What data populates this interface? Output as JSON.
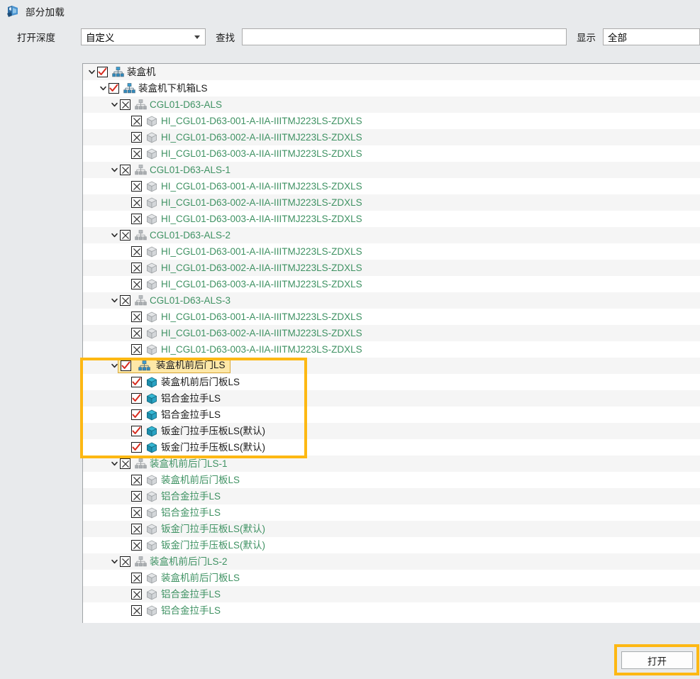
{
  "window": {
    "title": "部分加载",
    "icon": "partial-load-icon"
  },
  "toolbar": {
    "depth_label": "打开深度",
    "depth_value": "自定义",
    "find_label": "查找",
    "find_value": "",
    "find_placeholder": "",
    "show_label": "显示",
    "show_value": "全部"
  },
  "colors": {
    "highlight_border": "#fdb813",
    "selection_bg": "#fde8a8",
    "selection_border": "#d9a93a",
    "unloaded_text": "#3f9263",
    "loaded_text": "#1a1a1a",
    "check_red": "#d62b1f",
    "row_alt": "#f5f5f5",
    "panel_bg": "#e8eaec"
  },
  "tree": {
    "rows": [
      {
        "label": "装盒机",
        "depth": 0,
        "state": "checked",
        "icon": "assembly-icon-blue",
        "expanded": true,
        "text_style": "loaded",
        "selected": false
      },
      {
        "label": "装盒机下机箱LS",
        "depth": 1,
        "state": "checked",
        "icon": "assembly-icon-blue",
        "expanded": true,
        "text_style": "loaded",
        "selected": false
      },
      {
        "label": "CGL01-D63-ALS",
        "depth": 2,
        "state": "unchecked",
        "icon": "assembly-icon-gray",
        "expanded": true,
        "text_style": "unloaded",
        "selected": false
      },
      {
        "label": "HI_CGL01-D63-001-A-IIA-IIITMJ223LS-ZDXLS",
        "depth": 3,
        "state": "unchecked",
        "icon": "part-icon-gray",
        "expanded": null,
        "text_style": "unloaded",
        "selected": false
      },
      {
        "label": "HI_CGL01-D63-002-A-IIA-IIITMJ223LS-ZDXLS",
        "depth": 3,
        "state": "unchecked",
        "icon": "part-icon-gray",
        "expanded": null,
        "text_style": "unloaded",
        "selected": false
      },
      {
        "label": "HI_CGL01-D63-003-A-IIA-IIITMJ223LS-ZDXLS",
        "depth": 3,
        "state": "unchecked",
        "icon": "part-icon-gray",
        "expanded": null,
        "text_style": "unloaded",
        "selected": false
      },
      {
        "label": "CGL01-D63-ALS-1",
        "depth": 2,
        "state": "unchecked",
        "icon": "assembly-icon-gray",
        "expanded": true,
        "text_style": "unloaded",
        "selected": false
      },
      {
        "label": "HI_CGL01-D63-001-A-IIA-IIITMJ223LS-ZDXLS",
        "depth": 3,
        "state": "unchecked",
        "icon": "part-icon-gray",
        "expanded": null,
        "text_style": "unloaded",
        "selected": false
      },
      {
        "label": "HI_CGL01-D63-002-A-IIA-IIITMJ223LS-ZDXLS",
        "depth": 3,
        "state": "unchecked",
        "icon": "part-icon-gray",
        "expanded": null,
        "text_style": "unloaded",
        "selected": false
      },
      {
        "label": "HI_CGL01-D63-003-A-IIA-IIITMJ223LS-ZDXLS",
        "depth": 3,
        "state": "unchecked",
        "icon": "part-icon-gray",
        "expanded": null,
        "text_style": "unloaded",
        "selected": false
      },
      {
        "label": "CGL01-D63-ALS-2",
        "depth": 2,
        "state": "unchecked",
        "icon": "assembly-icon-gray",
        "expanded": true,
        "text_style": "unloaded",
        "selected": false
      },
      {
        "label": "HI_CGL01-D63-001-A-IIA-IIITMJ223LS-ZDXLS",
        "depth": 3,
        "state": "unchecked",
        "icon": "part-icon-gray",
        "expanded": null,
        "text_style": "unloaded",
        "selected": false
      },
      {
        "label": "HI_CGL01-D63-002-A-IIA-IIITMJ223LS-ZDXLS",
        "depth": 3,
        "state": "unchecked",
        "icon": "part-icon-gray",
        "expanded": null,
        "text_style": "unloaded",
        "selected": false
      },
      {
        "label": "HI_CGL01-D63-003-A-IIA-IIITMJ223LS-ZDXLS",
        "depth": 3,
        "state": "unchecked",
        "icon": "part-icon-gray",
        "expanded": null,
        "text_style": "unloaded",
        "selected": false
      },
      {
        "label": "CGL01-D63-ALS-3",
        "depth": 2,
        "state": "unchecked",
        "icon": "assembly-icon-gray",
        "expanded": true,
        "text_style": "unloaded",
        "selected": false
      },
      {
        "label": "HI_CGL01-D63-001-A-IIA-IIITMJ223LS-ZDXLS",
        "depth": 3,
        "state": "unchecked",
        "icon": "part-icon-gray",
        "expanded": null,
        "text_style": "unloaded",
        "selected": false
      },
      {
        "label": "HI_CGL01-D63-002-A-IIA-IIITMJ223LS-ZDXLS",
        "depth": 3,
        "state": "unchecked",
        "icon": "part-icon-gray",
        "expanded": null,
        "text_style": "unloaded",
        "selected": false
      },
      {
        "label": "HI_CGL01-D63-003-A-IIA-IIITMJ223LS-ZDXLS",
        "depth": 3,
        "state": "unchecked",
        "icon": "part-icon-gray",
        "expanded": null,
        "text_style": "unloaded",
        "selected": false
      },
      {
        "label": "装盒机前后门LS",
        "depth": 2,
        "state": "checked",
        "icon": "assembly-icon-blue",
        "expanded": true,
        "text_style": "loaded",
        "selected": true
      },
      {
        "label": "装盒机前后门板LS",
        "depth": 3,
        "state": "checked",
        "icon": "part-icon-blue",
        "expanded": null,
        "text_style": "loaded",
        "selected": false
      },
      {
        "label": "铝合金拉手LS",
        "depth": 3,
        "state": "checked",
        "icon": "part-icon-blue",
        "expanded": null,
        "text_style": "loaded",
        "selected": false
      },
      {
        "label": "铝合金拉手LS",
        "depth": 3,
        "state": "checked",
        "icon": "part-icon-blue",
        "expanded": null,
        "text_style": "loaded",
        "selected": false
      },
      {
        "label": "钣金门拉手压板LS(默认)",
        "depth": 3,
        "state": "checked",
        "icon": "part-icon-blue",
        "expanded": null,
        "text_style": "loaded",
        "selected": false
      },
      {
        "label": "钣金门拉手压板LS(默认)",
        "depth": 3,
        "state": "checked",
        "icon": "part-icon-blue",
        "expanded": null,
        "text_style": "loaded",
        "selected": false
      },
      {
        "label": "装盒机前后门LS-1",
        "depth": 2,
        "state": "unchecked",
        "icon": "assembly-icon-gray",
        "expanded": true,
        "text_style": "unloaded",
        "selected": false
      },
      {
        "label": "装盒机前后门板LS",
        "depth": 3,
        "state": "unchecked",
        "icon": "part-icon-gray",
        "expanded": null,
        "text_style": "unloaded",
        "selected": false
      },
      {
        "label": "铝合金拉手LS",
        "depth": 3,
        "state": "unchecked",
        "icon": "part-icon-gray",
        "expanded": null,
        "text_style": "unloaded",
        "selected": false
      },
      {
        "label": "铝合金拉手LS",
        "depth": 3,
        "state": "unchecked",
        "icon": "part-icon-gray",
        "expanded": null,
        "text_style": "unloaded",
        "selected": false
      },
      {
        "label": "钣金门拉手压板LS(默认)",
        "depth": 3,
        "state": "unchecked",
        "icon": "part-icon-gray",
        "expanded": null,
        "text_style": "unloaded",
        "selected": false
      },
      {
        "label": "钣金门拉手压板LS(默认)",
        "depth": 3,
        "state": "unchecked",
        "icon": "part-icon-gray",
        "expanded": null,
        "text_style": "unloaded",
        "selected": false
      },
      {
        "label": "装盒机前后门LS-2",
        "depth": 2,
        "state": "unchecked",
        "icon": "assembly-icon-gray",
        "expanded": true,
        "text_style": "unloaded",
        "selected": false
      },
      {
        "label": "装盒机前后门板LS",
        "depth": 3,
        "state": "unchecked",
        "icon": "part-icon-gray",
        "expanded": null,
        "text_style": "unloaded",
        "selected": false
      },
      {
        "label": "铝合金拉手LS",
        "depth": 3,
        "state": "unchecked",
        "icon": "part-icon-gray",
        "expanded": null,
        "text_style": "unloaded",
        "selected": false
      },
      {
        "label": "铝合金拉手LS",
        "depth": 3,
        "state": "unchecked",
        "icon": "part-icon-gray",
        "expanded": null,
        "text_style": "unloaded",
        "selected": false
      }
    ]
  },
  "footer": {
    "open_button": "打开"
  },
  "annotations": [
    {
      "name": "group-highlight",
      "target": "装盒机前后门LS"
    },
    {
      "name": "open-button-highlight",
      "target": "打开"
    }
  ]
}
